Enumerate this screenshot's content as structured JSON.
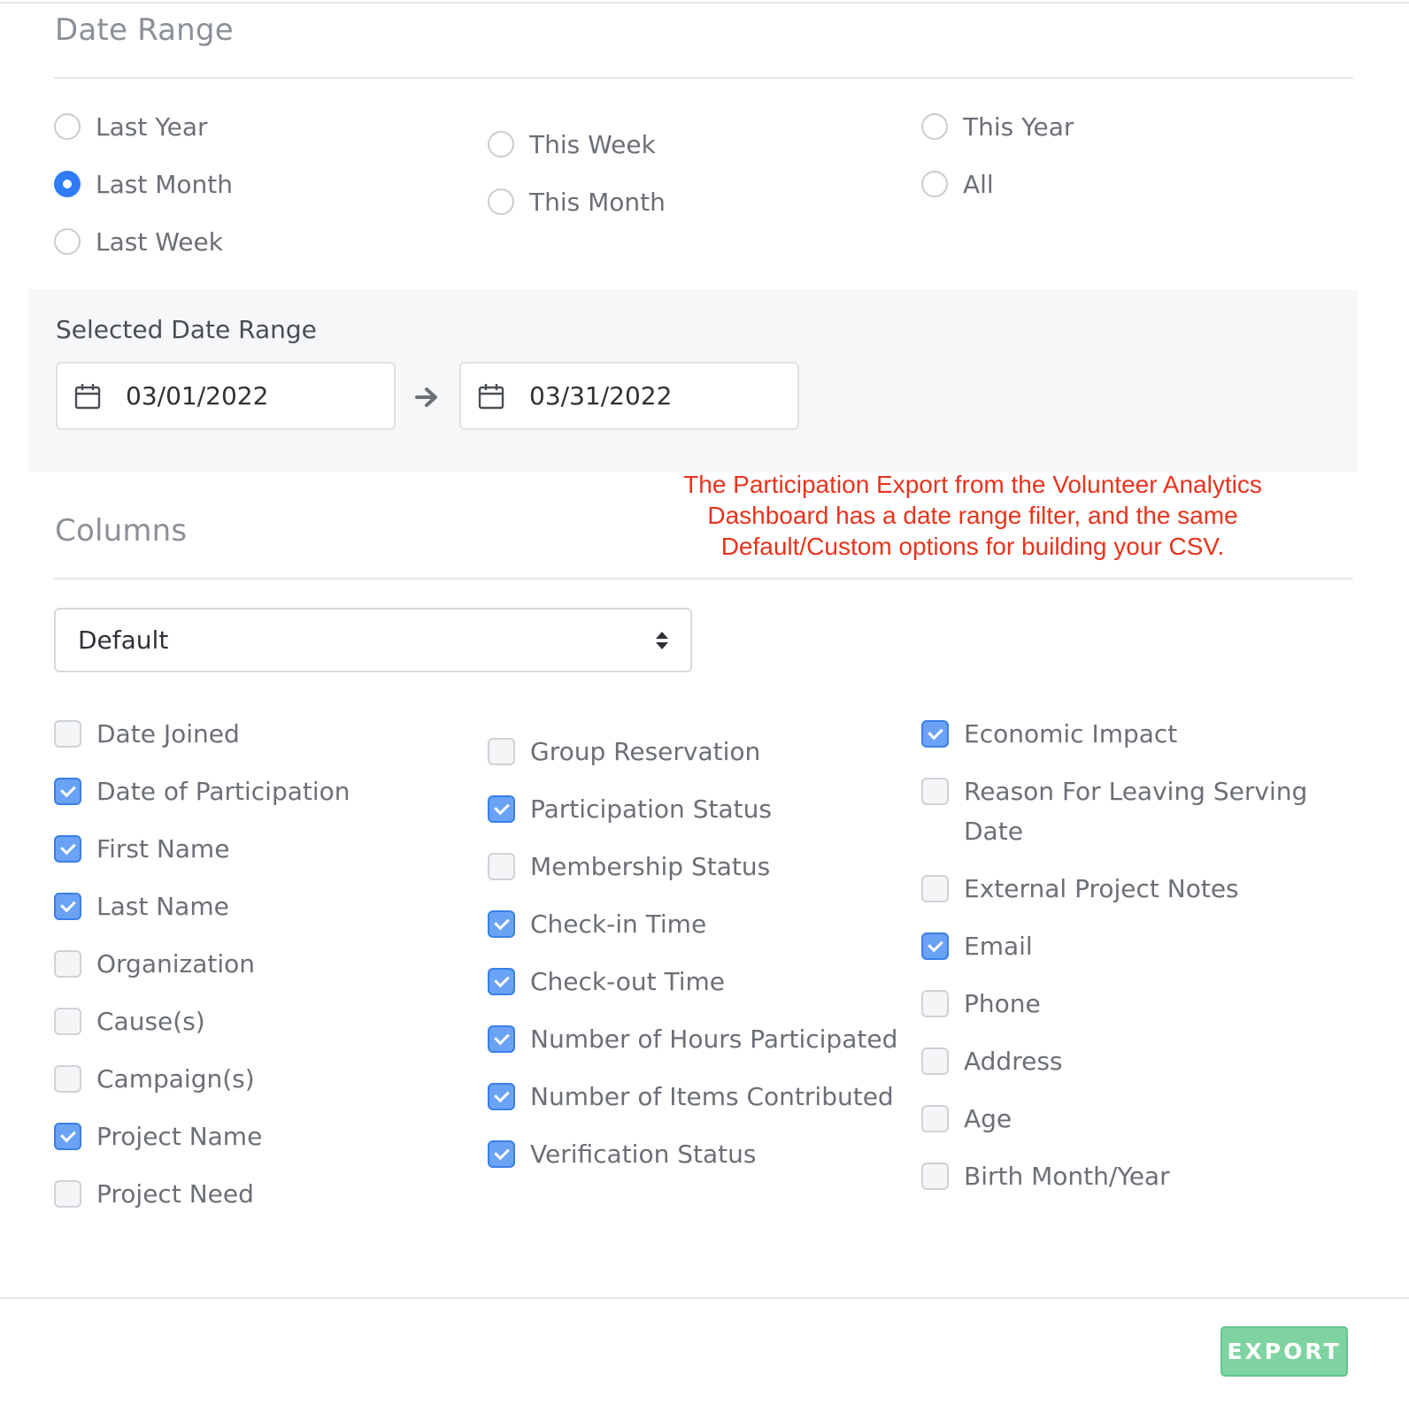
{
  "date_range": {
    "title": "Date Range",
    "options": [
      {
        "label": "Last Year",
        "selected": false
      },
      {
        "label": "Last Month",
        "selected": true
      },
      {
        "label": "Last Week",
        "selected": false
      },
      {
        "label": "This Week",
        "selected": false
      },
      {
        "label": "This Month",
        "selected": false
      },
      {
        "label": "This Year",
        "selected": false
      },
      {
        "label": "All",
        "selected": false
      }
    ]
  },
  "selected_range": {
    "label": "Selected Date Range",
    "start": "03/01/2022",
    "end": "03/31/2022"
  },
  "annotation": "The Participation Export from the Volunteer Analytics Dashboard has a date range filter, and the same Default/Custom options for building your CSV.",
  "columns": {
    "title": "Columns",
    "preset": "Default",
    "items": [
      {
        "label": "Date Joined",
        "checked": false
      },
      {
        "label": "Date of Participation",
        "checked": true
      },
      {
        "label": "First Name",
        "checked": true
      },
      {
        "label": "Last Name",
        "checked": true
      },
      {
        "label": "Organization",
        "checked": false
      },
      {
        "label": "Cause(s)",
        "checked": false
      },
      {
        "label": "Campaign(s)",
        "checked": false
      },
      {
        "label": "Project Name",
        "checked": true
      },
      {
        "label": "Project Need",
        "checked": false
      },
      {
        "label": "Group Reservation",
        "checked": false
      },
      {
        "label": "Participation Status",
        "checked": true
      },
      {
        "label": "Membership Status",
        "checked": false
      },
      {
        "label": "Check-in Time",
        "checked": true
      },
      {
        "label": "Check-out Time",
        "checked": true
      },
      {
        "label": "Number of Hours Participated",
        "checked": true
      },
      {
        "label": "Number of Items Contributed",
        "checked": true
      },
      {
        "label": "Verification Status",
        "checked": true
      },
      {
        "label": "Economic Impact",
        "checked": true
      },
      {
        "label": "Reason For Leaving Serving Date",
        "checked": false
      },
      {
        "label": "External Project Notes",
        "checked": false
      },
      {
        "label": "Email",
        "checked": true
      },
      {
        "label": "Phone",
        "checked": false
      },
      {
        "label": "Address",
        "checked": false
      },
      {
        "label": "Age",
        "checked": false
      },
      {
        "label": "Birth Month/Year",
        "checked": false
      }
    ]
  },
  "footer": {
    "export_label": "EXPORT",
    "export_color": "#7fd3a1"
  },
  "colors": {
    "accent": "#2f7cf6",
    "checkbox_checked": "#6aa2f5",
    "annotation": "#e8331d"
  }
}
